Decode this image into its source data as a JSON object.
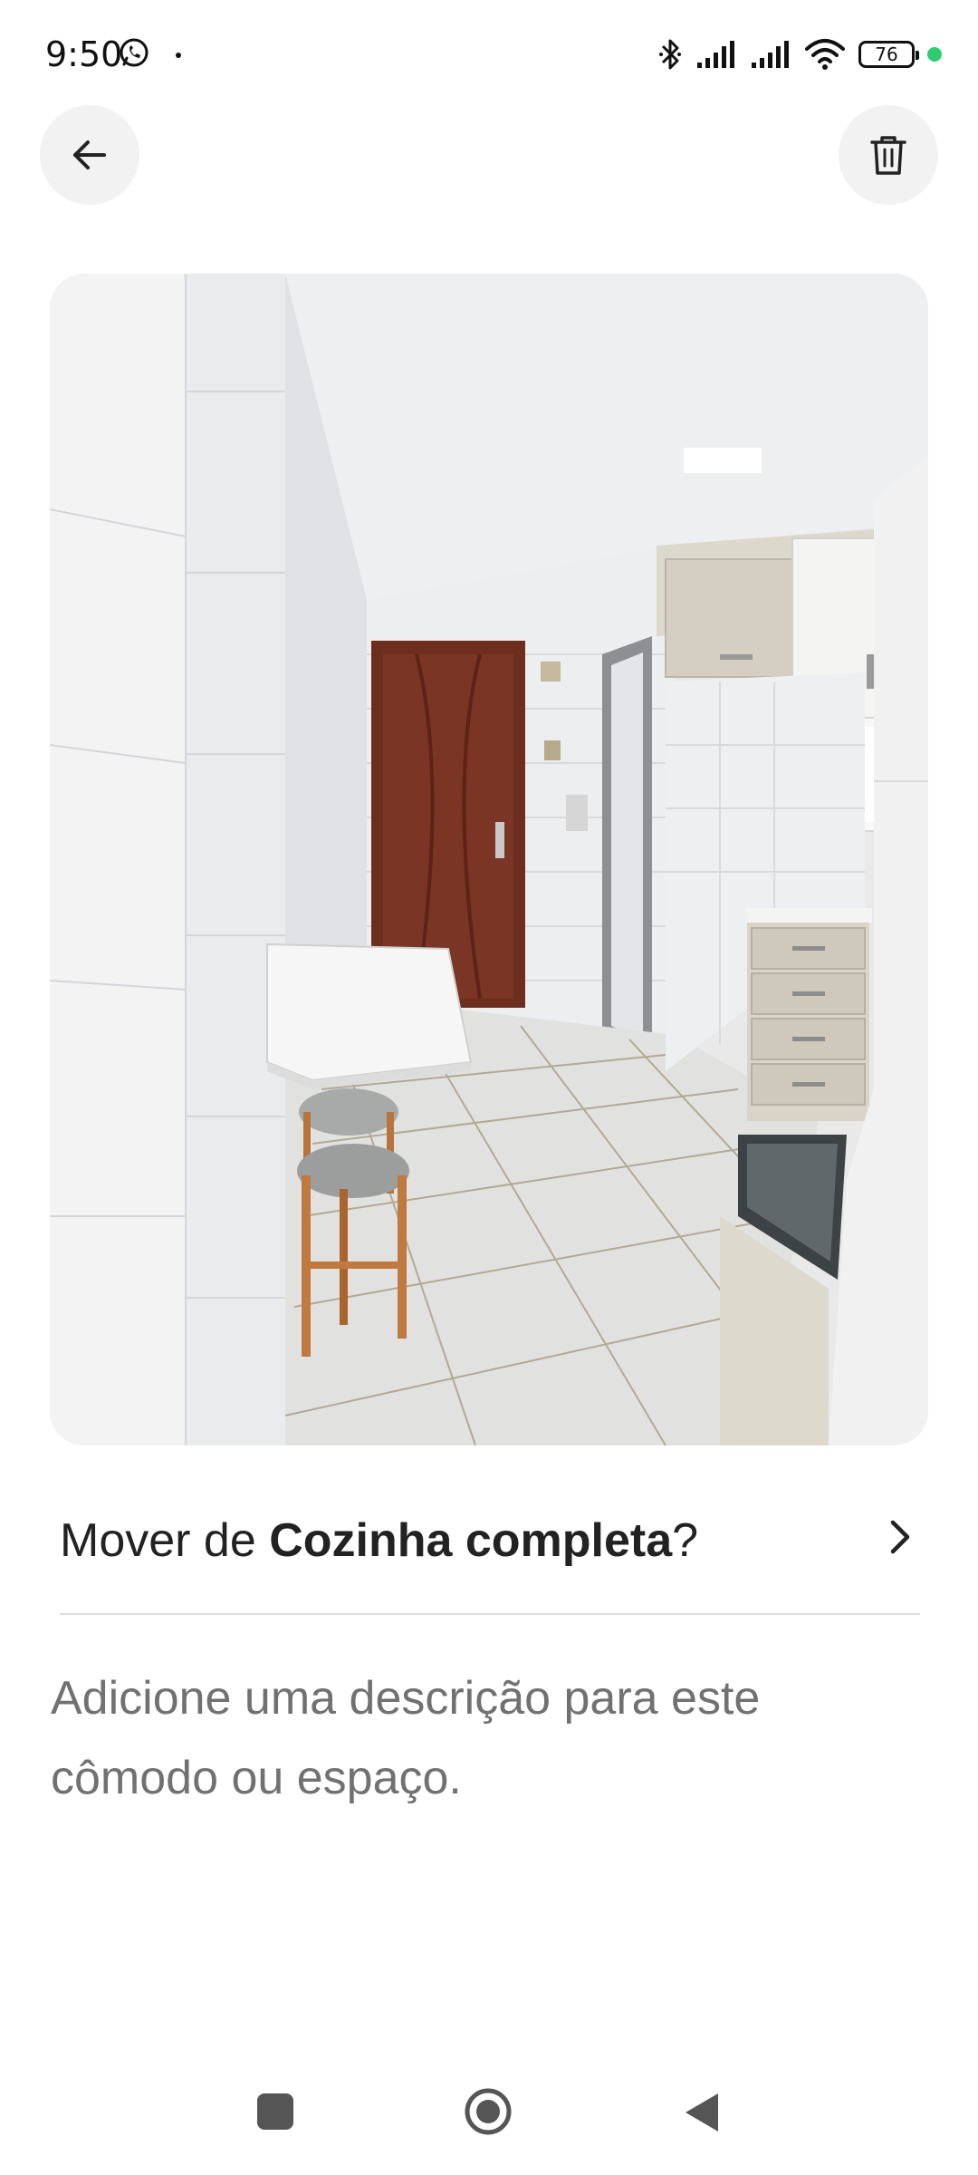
{
  "status_bar": {
    "time": "9:50",
    "battery_level": "76",
    "charging_dot_color": "#2ecc71",
    "icons": [
      "whatsapp-icon",
      "bluetooth-icon",
      "signal-icon",
      "signal-icon",
      "wifi-icon",
      "battery-icon"
    ]
  },
  "header": {
    "back_icon": "arrow-left-icon",
    "delete_icon": "trash-icon"
  },
  "photo": {
    "subject": "kitchen-room-photo"
  },
  "move": {
    "prefix": "Mover de ",
    "room": "Cozinha completa",
    "suffix": "?",
    "icon": "chevron-right-icon"
  },
  "description": {
    "placeholder": "Adicione uma descrição para este cômodo ou espaço."
  },
  "nav_bar": {
    "icons": [
      "recents-icon",
      "home-icon",
      "back-icon"
    ]
  }
}
